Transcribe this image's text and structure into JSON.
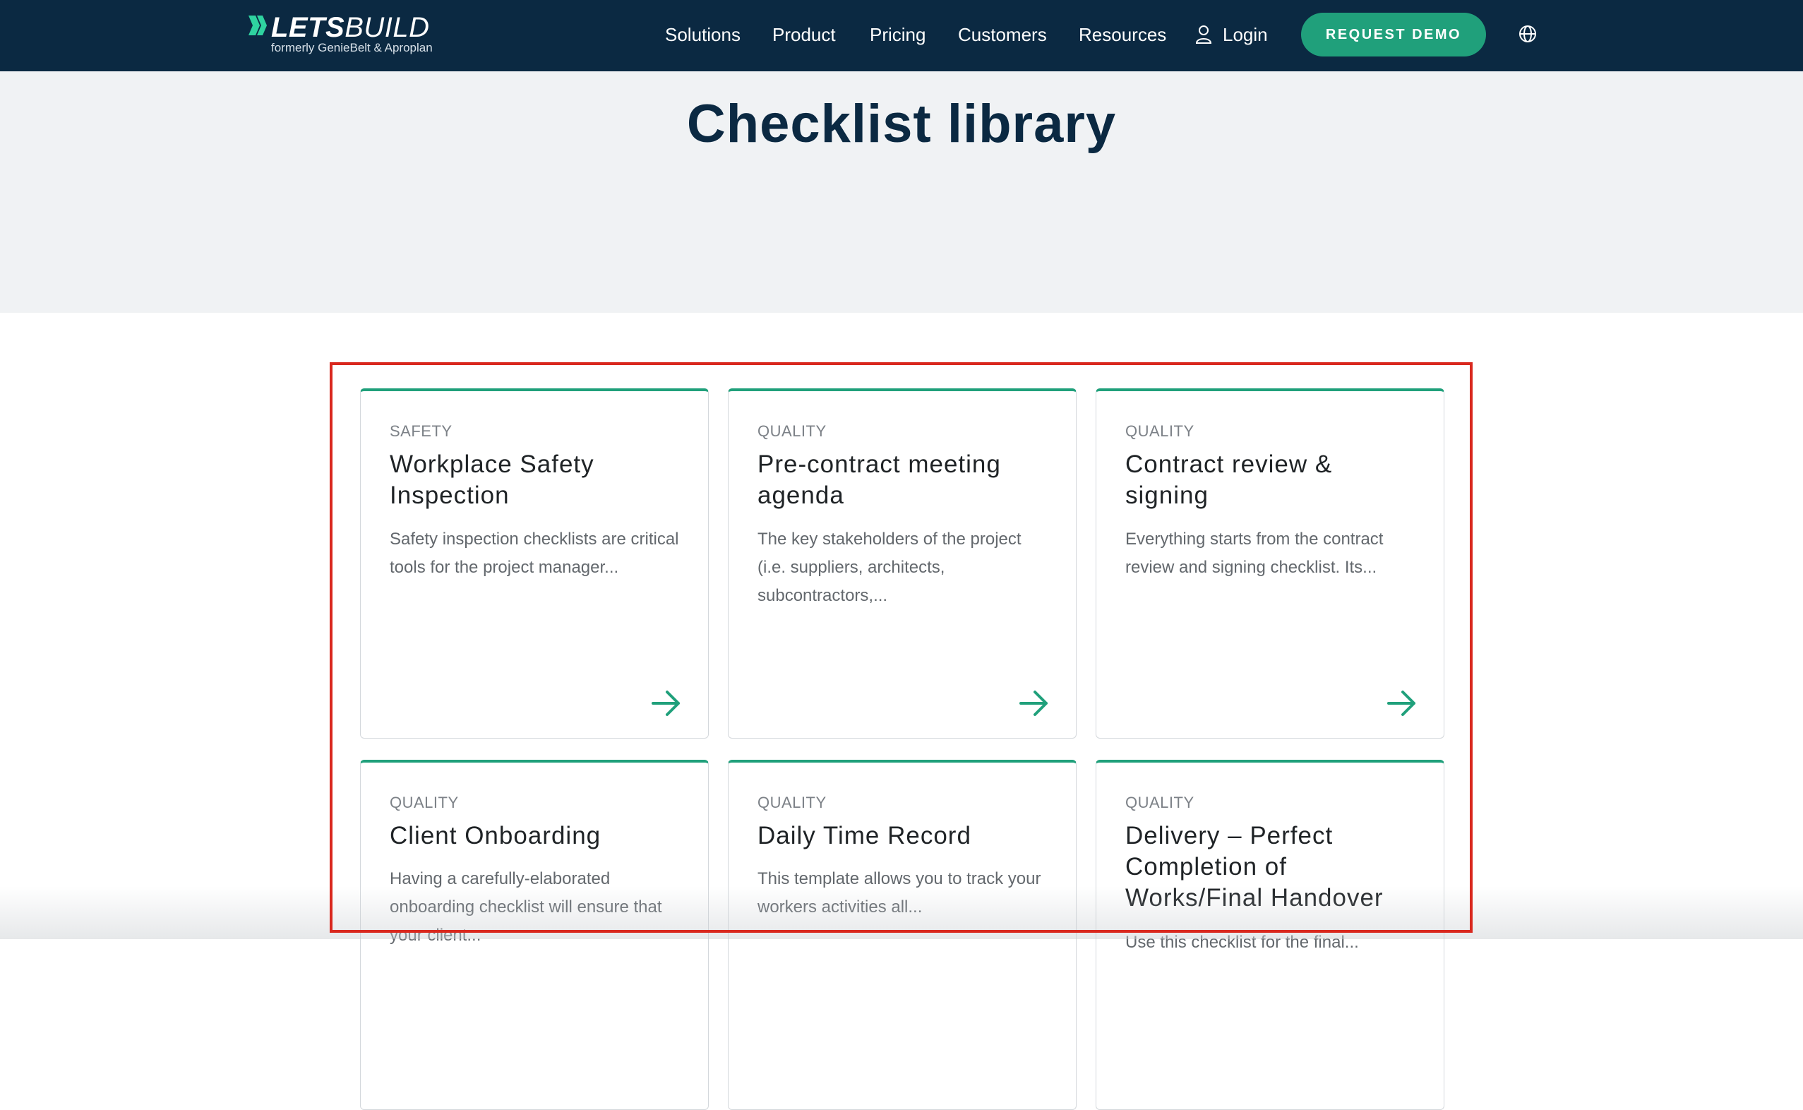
{
  "header": {
    "logo": {
      "word_bold": "LETS",
      "word_light": "BUILD",
      "subtitle": "formerly GenieBelt & Aproplan",
      "mark_icon": "double-chevron-logo-mark"
    },
    "nav": [
      {
        "label": "Solutions"
      },
      {
        "label": "Product"
      },
      {
        "label": "Pricing"
      },
      {
        "label": "Customers"
      },
      {
        "label": "Resources"
      }
    ],
    "login_label": "Login",
    "login_icon": "user-icon",
    "demo_button": "REQUEST DEMO",
    "language_icon": "globe-icon"
  },
  "page": {
    "title": "Checklist library"
  },
  "cards": [
    {
      "category": "SAFETY",
      "title": "Workplace Safety Inspection",
      "description": "Safety inspection checklists are critical tools for the project manager..."
    },
    {
      "category": "QUALITY",
      "title": "Pre-contract meeting agenda",
      "description": "The key stakeholders of the project (i.e. suppliers, architects, subcontractors,..."
    },
    {
      "category": "QUALITY",
      "title": "Contract review & signing",
      "description": "Everything starts from the contract review and signing checklist. Its..."
    },
    {
      "category": "QUALITY",
      "title": "Client Onboarding",
      "description": "Having a carefully-elaborated onboarding checklist will ensure that your client..."
    },
    {
      "category": "QUALITY",
      "title": "Daily Time Record",
      "description": "This template allows you to track your workers activities all..."
    },
    {
      "category": "QUALITY",
      "title": "Delivery – Perfect Completion of Works/Final Handover",
      "description": "Use this checklist for the final..."
    }
  ],
  "colors": {
    "navbar": "#0b2942",
    "accent": "#20a07b",
    "hero_bg": "#f0f2f4",
    "highlight": "#d9281e"
  },
  "card_arrow_icon": "arrow-right-icon"
}
